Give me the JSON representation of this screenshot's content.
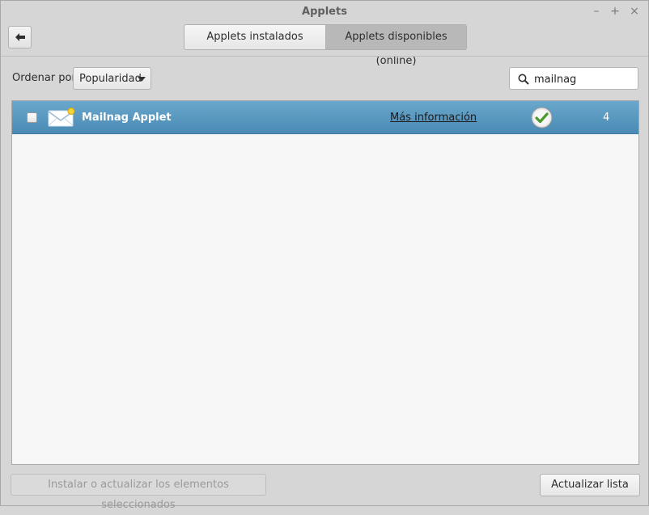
{
  "window": {
    "title": "Applets",
    "minimize_glyph": "–",
    "maximize_glyph": "+",
    "close_glyph": "×"
  },
  "header": {
    "back_icon": "back-arrow-icon",
    "tabs": [
      {
        "label": "Applets instalados",
        "active": false
      },
      {
        "label": "Applets disponibles (online)",
        "active": true
      }
    ]
  },
  "toolbar": {
    "sort_label": "Ordenar por",
    "sort_value": "Popularidad",
    "search_value": "mailnag",
    "search_icon": "magnifier-icon"
  },
  "list": {
    "rows": [
      {
        "checked": false,
        "icon": "mail-envelope-icon",
        "name": "Mailnag Applet",
        "more_info": "Más información",
        "status_icon": "installed-check-icon",
        "score": "4",
        "selected": true
      }
    ]
  },
  "footer": {
    "install_label": "Instalar o actualizar los elementos seleccionados",
    "install_enabled": false,
    "refresh_label": "Actualizar lista"
  },
  "colors": {
    "selection": "#4f8eb8",
    "window_bg": "#d6d6d6",
    "list_bg": "#f7f7f7",
    "check_green": "#4a9a2a"
  }
}
